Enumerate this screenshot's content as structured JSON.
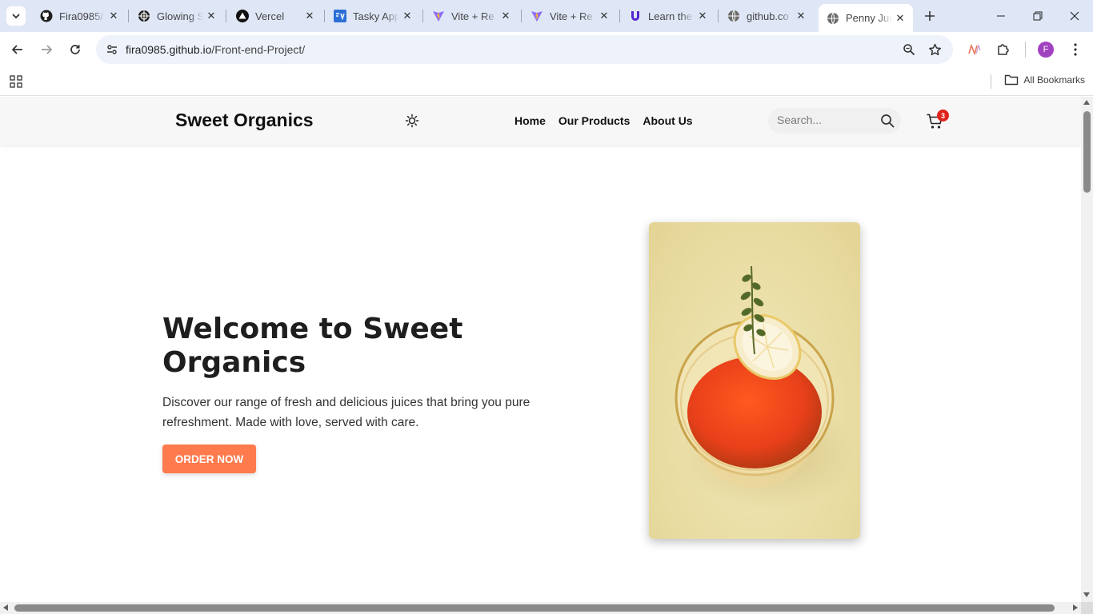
{
  "browser": {
    "tabs": [
      {
        "label": "Fira0985/",
        "icon": "github-icon"
      },
      {
        "label": "Glowing S",
        "icon": "globe-icon"
      },
      {
        "label": "Vercel",
        "icon": "vercel-icon"
      },
      {
        "label": "Tasky App",
        "icon": "tasky-icon"
      },
      {
        "label": "Vite + Re",
        "icon": "vite-icon"
      },
      {
        "label": "Vite + Re",
        "icon": "vite-icon"
      },
      {
        "label": "Learn the",
        "icon": "udemy-icon"
      },
      {
        "label": "github.co",
        "icon": "globe-icon"
      },
      {
        "label": "Penny Jui",
        "icon": "globe-icon",
        "active": true
      }
    ],
    "url_host": "fira0985.github.io",
    "url_path": "/Front-end-Project/",
    "profile_initial": "F",
    "all_bookmarks_label": "All Bookmarks"
  },
  "site": {
    "brand": "Sweet Organics",
    "nav": [
      "Home",
      "Our Products",
      "About Us"
    ],
    "search_placeholder": "Search...",
    "cart_count": "3",
    "accent_color": "#ff7a4d",
    "badge_color": "#e0231b"
  },
  "hero": {
    "title": "Welcome to Sweet Organics",
    "text": "Discover our range of fresh and delicious juices that bring you pure refreshment. Made with love, served with care.",
    "cta": "ORDER NOW",
    "image_alt": "glass of juice with lemon and thyme"
  }
}
